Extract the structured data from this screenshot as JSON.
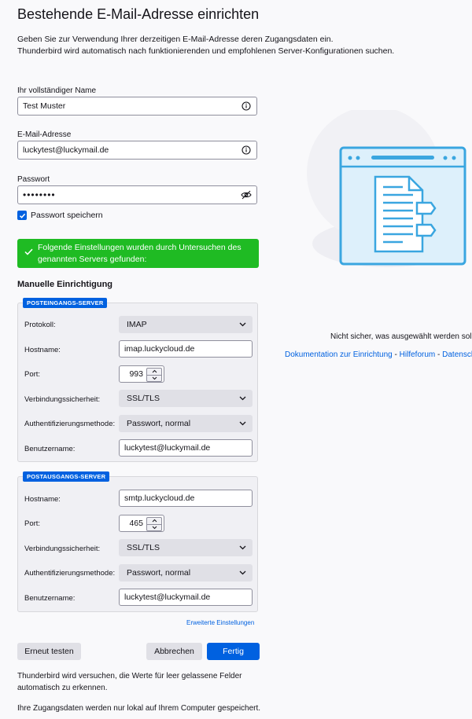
{
  "header": {
    "title": "Bestehende E-Mail-Adresse einrichten",
    "intro_line1": "Geben Sie zur Verwendung Ihrer derzeitigen E-Mail-Adresse deren Zugangsdaten ein.",
    "intro_line2": "Thunderbird wird automatisch nach funktionierenden und empfohlenen Server-Konfigurationen suchen."
  },
  "form": {
    "name_label": "Ihr vollständiger Name",
    "name_value": "Test Muster",
    "email_label": "E-Mail-Adresse",
    "email_value": "luckytest@luckymail.de",
    "password_label": "Passwort",
    "password_value": "••••••••",
    "remember_label": "Passwort speichern",
    "remember_checked": true
  },
  "success_message": "Folgende Einstellungen wurden durch Untersuchen des genannten Servers gefunden:",
  "manual": {
    "title": "Manuelle Einrichtigung",
    "incoming": {
      "badge": "POSTEINGANGS-SERVER",
      "protocol_label": "Protokoll:",
      "protocol_value": "IMAP",
      "hostname_label": "Hostname:",
      "hostname_value": "imap.luckycloud.de",
      "port_label": "Port:",
      "port_value": "993",
      "security_label": "Verbindungssicherheit:",
      "security_value": "SSL/TLS",
      "auth_label": "Authentifizierungsmethode:",
      "auth_value": "Passwort, normal",
      "username_label": "Benutzername:",
      "username_value": "luckytest@luckymail.de"
    },
    "outgoing": {
      "badge": "POSTAUSGANGS-SERVER",
      "hostname_label": "Hostname:",
      "hostname_value": "smtp.luckycloud.de",
      "port_label": "Port:",
      "port_value": "465",
      "security_label": "Verbindungssicherheit:",
      "security_value": "SSL/TLS",
      "auth_label": "Authentifizierungsmethode:",
      "auth_value": "Passwort, normal",
      "username_label": "Benutzername:",
      "username_value": "luckytest@luckymail.de"
    },
    "advanced_link": "Erweiterte Einstellungen"
  },
  "buttons": {
    "retest": "Erneut testen",
    "cancel": "Abbrechen",
    "done": "Fertig"
  },
  "notes": {
    "line1": "Thunderbird wird versuchen, die Werte für leer gelassene Felder",
    "line2": "automatisch zu erkennen.",
    "line3": "Ihre Zugangsdaten werden nur lokal auf Ihrem Computer gespeichert."
  },
  "side": {
    "unsure_text": "Nicht sicher, was ausgewählt werden soll?",
    "link_docs": "Dokumentation zur Einrichtung",
    "separator": "-",
    "link_forum": "Hilfeforum",
    "link_privacy": "Datenschutz"
  },
  "icons": {
    "info": "info-icon",
    "eye_off": "eye-off-icon",
    "checkmark": "checkmark-icon",
    "chevron": "chevron-down-icon",
    "illustration": "document-browser-illustration"
  },
  "colors": {
    "accent": "#0061e0",
    "success": "#1fbb23",
    "illustration": "#3aa6e0"
  }
}
